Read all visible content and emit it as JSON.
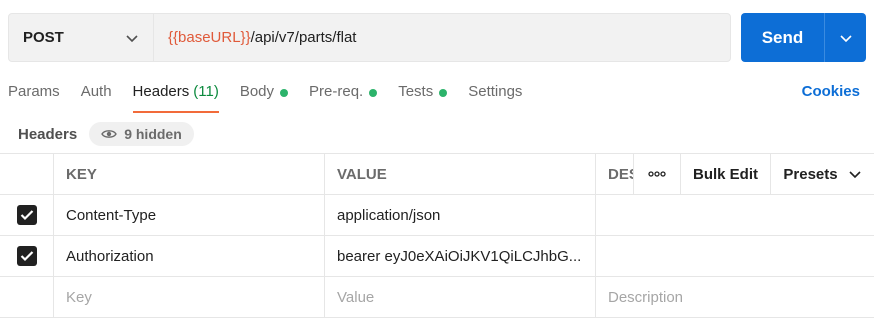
{
  "request": {
    "method": "POST",
    "url_variable": "{{baseURL}}",
    "url_path": "/api/v7/parts/flat",
    "send_label": "Send"
  },
  "tabs": [
    {
      "label": "Params"
    },
    {
      "label": "Auth"
    },
    {
      "label": "Headers",
      "count": "(11)",
      "active": true
    },
    {
      "label": "Body",
      "dot": true
    },
    {
      "label": "Pre-req.",
      "dot": true
    },
    {
      "label": "Tests",
      "dot": true
    },
    {
      "label": "Settings"
    }
  ],
  "cookies_label": "Cookies",
  "headers_section": {
    "title": "Headers",
    "hidden_label": "9 hidden"
  },
  "table": {
    "columns": {
      "key": "KEY",
      "value": "VALUE",
      "description": "DES"
    },
    "bulk_edit_label": "Bulk Edit",
    "presets_label": "Presets",
    "rows": [
      {
        "key": "Content-Type",
        "value": "application/json",
        "description": "",
        "checked": true
      },
      {
        "key": "Authorization",
        "value": "bearer eyJ0eXAiOiJKV1QiLCJhbG...",
        "description": "",
        "checked": true
      }
    ],
    "placeholder": {
      "key": "Key",
      "value": "Value",
      "description": "Description"
    }
  },
  "colors": {
    "accent": "#0d6ed6",
    "active_tab_underline": "#f26b3a",
    "variable": "#e05a3a",
    "dot": "#2cb36b"
  },
  "icons": {
    "method_dropdown": "chevron-down-icon",
    "send_dropdown": "chevron-down-icon",
    "hidden": "eye-icon",
    "more": "ellipsis-icon",
    "check": "checkmark-icon"
  }
}
